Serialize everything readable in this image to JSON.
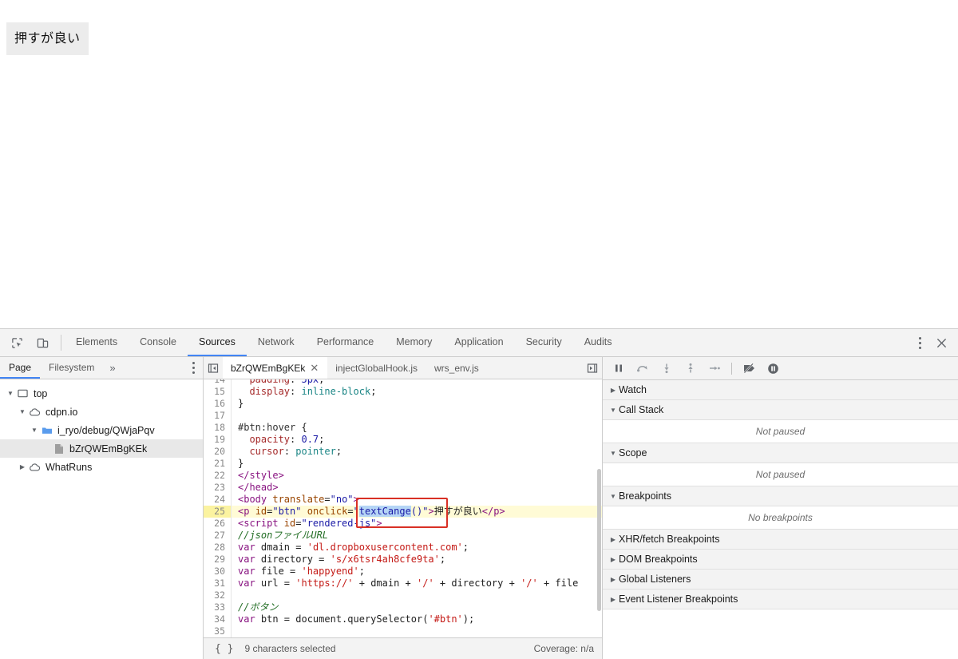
{
  "page": {
    "button_label": "押すが良い",
    "button_bg": "#ececec"
  },
  "devtools": {
    "main_tabs": [
      {
        "label": "Elements",
        "active": false
      },
      {
        "label": "Console",
        "active": false
      },
      {
        "label": "Sources",
        "active": true
      },
      {
        "label": "Network",
        "active": false
      },
      {
        "label": "Performance",
        "active": false
      },
      {
        "label": "Memory",
        "active": false
      },
      {
        "label": "Application",
        "active": false
      },
      {
        "label": "Security",
        "active": false
      },
      {
        "label": "Audits",
        "active": false
      }
    ],
    "accent_color": "#4285f4",
    "inspect_icon": "inspect-element-icon",
    "device_icon": "device-toolbar-icon",
    "more_icon": "more-options-icon",
    "close_icon": "close-devtools-icon"
  },
  "navigator": {
    "tabs": [
      {
        "label": "Page",
        "active": true
      },
      {
        "label": "Filesystem",
        "active": false
      }
    ],
    "more_label": "»",
    "tree": [
      {
        "label": "top",
        "indent": 0,
        "twisty": "▼",
        "icon": "frame-icon",
        "selected": false
      },
      {
        "label": "cdpn.io",
        "indent": 1,
        "twisty": "▼",
        "icon": "cloud-icon",
        "selected": false
      },
      {
        "label": "i_ryo/debug/QWjaPqv",
        "indent": 2,
        "twisty": "▼",
        "icon": "folder-icon",
        "selected": false
      },
      {
        "label": "bZrQWEmBgKEk",
        "indent": 3,
        "twisty": "",
        "icon": "document-icon",
        "selected": true
      },
      {
        "label": "WhatRuns",
        "indent": 1,
        "twisty": "▶",
        "icon": "cloud-icon",
        "selected": false
      }
    ]
  },
  "editor": {
    "tabs": [
      {
        "label": "bZrQWEmBgKEk",
        "active": true,
        "closable": true
      },
      {
        "label": "injectGlobalHook.js",
        "active": false,
        "closable": false
      },
      {
        "label": "wrs_env.js",
        "active": false,
        "closable": false
      }
    ],
    "scroll_left_icon": "scroll-tabs-left-icon",
    "scroll_right_icon": "scroll-tabs-right-icon",
    "selection_text": "textCange",
    "lines": [
      {
        "n": 14,
        "clipped": true,
        "tokens": [
          {
            "t": "  ",
            "c": "s-plain"
          },
          {
            "t": "padding",
            "c": "s-prop"
          },
          {
            "t": ": ",
            "c": "s-punc"
          },
          {
            "t": "5px",
            "c": "s-num"
          },
          {
            "t": ";",
            "c": "s-punc"
          }
        ]
      },
      {
        "n": 15,
        "tokens": [
          {
            "t": "  ",
            "c": "s-plain"
          },
          {
            "t": "display",
            "c": "s-prop"
          },
          {
            "t": ": ",
            "c": "s-punc"
          },
          {
            "t": "inline-block",
            "c": "s-val"
          },
          {
            "t": ";",
            "c": "s-punc"
          }
        ]
      },
      {
        "n": 16,
        "tokens": [
          {
            "t": "}",
            "c": "s-punc"
          }
        ]
      },
      {
        "n": 17,
        "tokens": [
          {
            "t": "",
            "c": "s-plain"
          }
        ]
      },
      {
        "n": 18,
        "tokens": [
          {
            "t": "#btn:hover",
            "c": "s-sel"
          },
          {
            "t": " {",
            "c": "s-punc"
          }
        ]
      },
      {
        "n": 19,
        "tokens": [
          {
            "t": "  ",
            "c": "s-plain"
          },
          {
            "t": "opacity",
            "c": "s-prop"
          },
          {
            "t": ": ",
            "c": "s-punc"
          },
          {
            "t": "0.7",
            "c": "s-num"
          },
          {
            "t": ";",
            "c": "s-punc"
          }
        ]
      },
      {
        "n": 20,
        "tokens": [
          {
            "t": "  ",
            "c": "s-plain"
          },
          {
            "t": "cursor",
            "c": "s-prop"
          },
          {
            "t": ": ",
            "c": "s-punc"
          },
          {
            "t": "pointer",
            "c": "s-val"
          },
          {
            "t": ";",
            "c": "s-punc"
          }
        ]
      },
      {
        "n": 21,
        "tokens": [
          {
            "t": "}",
            "c": "s-punc"
          }
        ]
      },
      {
        "n": 22,
        "tokens": [
          {
            "t": "</style>",
            "c": "s-tag"
          }
        ]
      },
      {
        "n": 23,
        "tokens": [
          {
            "t": "</head>",
            "c": "s-tag"
          }
        ]
      },
      {
        "n": 24,
        "tokens": [
          {
            "t": "<body ",
            "c": "s-tag"
          },
          {
            "t": "translate",
            "c": "s-attr"
          },
          {
            "t": "=",
            "c": "s-punc"
          },
          {
            "t": "\"no\"",
            "c": "s-str"
          },
          {
            "t": ">",
            "c": "s-tag"
          }
        ]
      },
      {
        "n": 25,
        "highlight": true,
        "tokens": [
          {
            "t": "<p ",
            "c": "s-tag"
          },
          {
            "t": "id",
            "c": "s-attr"
          },
          {
            "t": "=",
            "c": "s-punc"
          },
          {
            "t": "\"btn\"",
            "c": "s-str"
          },
          {
            "t": " ",
            "c": "s-plain"
          },
          {
            "t": "onclick",
            "c": "s-attr"
          },
          {
            "t": "=",
            "c": "s-punc"
          },
          {
            "t": "\"",
            "c": "s-str"
          },
          {
            "t": "textCange",
            "c": "s-str",
            "sel": true
          },
          {
            "t": "()\"",
            "c": "s-str"
          },
          {
            "t": ">",
            "c": "s-tag"
          },
          {
            "t": "押すが良い",
            "c": "s-plain"
          },
          {
            "t": "</p>",
            "c": "s-tag"
          }
        ]
      },
      {
        "n": 26,
        "tokens": [
          {
            "t": "<script ",
            "c": "s-tag"
          },
          {
            "t": "id",
            "c": "s-attr"
          },
          {
            "t": "=",
            "c": "s-punc"
          },
          {
            "t": "\"rendered-js\"",
            "c": "s-str"
          },
          {
            "t": ">",
            "c": "s-tag"
          }
        ]
      },
      {
        "n": 27,
        "tokens": [
          {
            "t": "//jsonファイルURL",
            "c": "s-cmt"
          }
        ]
      },
      {
        "n": 28,
        "tokens": [
          {
            "t": "var",
            "c": "s-kw"
          },
          {
            "t": " dmain = ",
            "c": "s-plain"
          },
          {
            "t": "'dl.dropboxusercontent.com'",
            "c": "s-jstr"
          },
          {
            "t": ";",
            "c": "s-punc"
          }
        ]
      },
      {
        "n": 29,
        "tokens": [
          {
            "t": "var",
            "c": "s-kw"
          },
          {
            "t": " directory = ",
            "c": "s-plain"
          },
          {
            "t": "'s/x6tsr4ah8cfe9ta'",
            "c": "s-jstr"
          },
          {
            "t": ";",
            "c": "s-punc"
          }
        ]
      },
      {
        "n": 30,
        "tokens": [
          {
            "t": "var",
            "c": "s-kw"
          },
          {
            "t": " file = ",
            "c": "s-plain"
          },
          {
            "t": "'happyend'",
            "c": "s-jstr"
          },
          {
            "t": ";",
            "c": "s-punc"
          }
        ]
      },
      {
        "n": 31,
        "tokens": [
          {
            "t": "var",
            "c": "s-kw"
          },
          {
            "t": " url = ",
            "c": "s-plain"
          },
          {
            "t": "'https://'",
            "c": "s-jstr"
          },
          {
            "t": " + dmain + ",
            "c": "s-plain"
          },
          {
            "t": "'/'",
            "c": "s-jstr"
          },
          {
            "t": " + directory + ",
            "c": "s-plain"
          },
          {
            "t": "'/'",
            "c": "s-jstr"
          },
          {
            "t": " + file",
            "c": "s-plain"
          }
        ]
      },
      {
        "n": 32,
        "tokens": [
          {
            "t": "",
            "c": "s-plain"
          }
        ]
      },
      {
        "n": 33,
        "tokens": [
          {
            "t": "//ボタン",
            "c": "s-cmt"
          }
        ]
      },
      {
        "n": 34,
        "tokens": [
          {
            "t": "var",
            "c": "s-kw"
          },
          {
            "t": " btn = document.querySelector(",
            "c": "s-plain"
          },
          {
            "t": "'#btn'",
            "c": "s-jstr"
          },
          {
            "t": ");",
            "c": "s-punc"
          }
        ]
      },
      {
        "n": 35,
        "tokens": [
          {
            "t": "",
            "c": "s-plain"
          }
        ]
      }
    ],
    "status": {
      "pretty_print_label": "{ }",
      "selection_status": "9 characters selected",
      "coverage": "Coverage: n/a"
    }
  },
  "debugger": {
    "toolbar_icons": [
      "pause-script-icon",
      "step-over-icon",
      "step-into-icon",
      "step-out-icon",
      "step-icon",
      "deactivate-breakpoints-icon",
      "pause-on-exceptions-icon"
    ],
    "sections": [
      {
        "title": "Watch",
        "expanded": false,
        "empty_text": null
      },
      {
        "title": "Call Stack",
        "expanded": true,
        "empty_text": "Not paused"
      },
      {
        "title": "Scope",
        "expanded": true,
        "empty_text": "Not paused"
      },
      {
        "title": "Breakpoints",
        "expanded": true,
        "empty_text": "No breakpoints"
      },
      {
        "title": "XHR/fetch Breakpoints",
        "expanded": false,
        "empty_text": null
      },
      {
        "title": "DOM Breakpoints",
        "expanded": false,
        "empty_text": null
      },
      {
        "title": "Global Listeners",
        "expanded": false,
        "empty_text": null
      },
      {
        "title": "Event Listener Breakpoints",
        "expanded": false,
        "empty_text": null
      }
    ]
  }
}
